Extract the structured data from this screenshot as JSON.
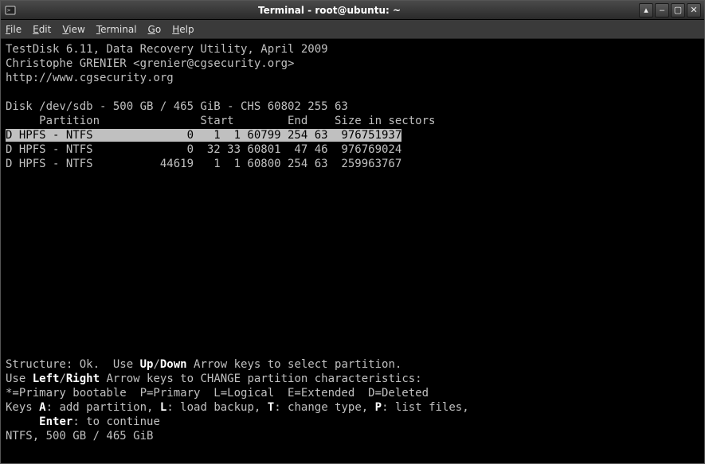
{
  "titlebar": {
    "title": "Terminal - root@ubuntu: ~"
  },
  "menubar": {
    "file": "File",
    "edit": "Edit",
    "view": "View",
    "terminal": "Terminal",
    "go": "Go",
    "help": "Help"
  },
  "header": {
    "line1": "TestDisk 6.11, Data Recovery Utility, April 2009",
    "line2": "Christophe GRENIER <grenier@cgsecurity.org>",
    "line3": "http://www.cgsecurity.org"
  },
  "disk_line": "Disk /dev/sdb - 500 GB / 465 GiB - CHS 60802 255 63",
  "table": {
    "header": "     Partition               Start        End    Size in sectors",
    "rows": [
      {
        "selected": true,
        "text": "D HPFS - NTFS              0   1  1 60799 254 63  976751937"
      },
      {
        "selected": false,
        "text": "D HPFS - NTFS              0  32 33 60801  47 46  976769024"
      },
      {
        "selected": false,
        "text": "D HPFS - NTFS          44619   1  1 60800 254 63  259963767"
      }
    ]
  },
  "footer": {
    "structure_prefix": "Structure: Ok.  Use ",
    "up": "Up",
    "slash": "/",
    "down": "Down",
    "structure_suffix": " Arrow keys to select partition.",
    "lr_prefix": "Use ",
    "left": "Left",
    "right": "Right",
    "lr_suffix": " Arrow keys to CHANGE partition characteristics:",
    "legend": "*=Primary bootable  P=Primary  L=Logical  E=Extended  D=Deleted",
    "keys_prefix": "Keys ",
    "key_a": "A",
    "a_text": ": add partition, ",
    "key_l": "L",
    "l_text": ": load backup, ",
    "key_t": "T",
    "t_text": ": change type, ",
    "key_p": "P",
    "p_text": ": list files,",
    "enter_indent": "     ",
    "enter": "Enter",
    "enter_text": ": to continue",
    "ntfs": "NTFS, 500 GB / 465 GiB"
  }
}
